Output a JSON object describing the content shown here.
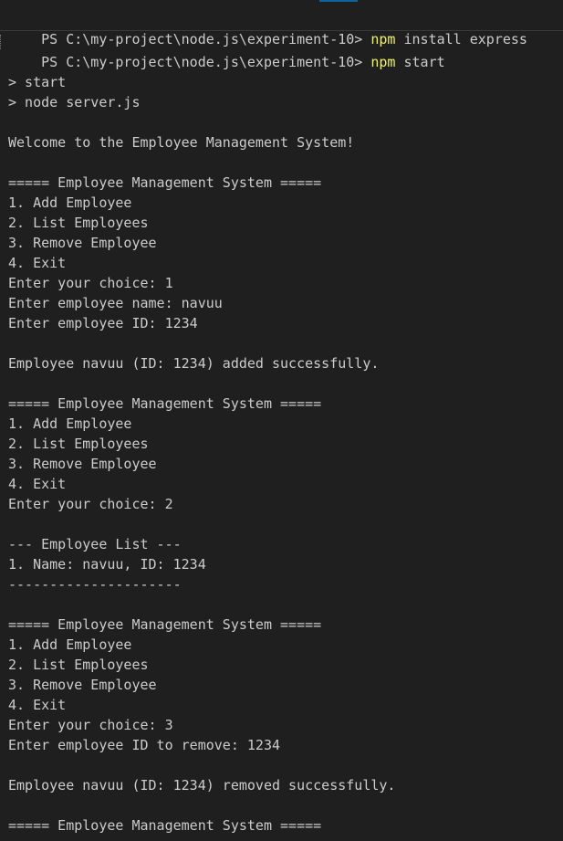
{
  "terminal": {
    "prompts": [
      {
        "ps": "PS C:\\my-project\\node.js\\experiment-10> ",
        "cmd": "npm",
        "args": " install express"
      },
      {
        "ps": "PS C:\\my-project\\node.js\\experiment-10> ",
        "cmd": "npm",
        "args": " start"
      }
    ],
    "output": [
      "",
      "> start",
      "> node server.js",
      "",
      "Welcome to the Employee Management System!",
      "",
      "===== Employee Management System =====",
      "1. Add Employee",
      "2. List Employees",
      "3. Remove Employee",
      "4. Exit",
      "Enter your choice: 1",
      "Enter employee name: navuu",
      "Enter employee ID: 1234",
      "",
      "Employee navuu (ID: 1234) added successfully.",
      "",
      "===== Employee Management System =====",
      "1. Add Employee",
      "2. List Employees",
      "3. Remove Employee",
      "4. Exit",
      "Enter your choice: 2",
      "",
      "--- Employee List ---",
      "1. Name: navuu, ID: 1234",
      "---------------------",
      "",
      "===== Employee Management System =====",
      "1. Add Employee",
      "2. List Employees",
      "3. Remove Employee",
      "4. Exit",
      "Enter your choice: 3",
      "Enter employee ID to remove: 1234",
      "",
      "Employee navuu (ID: 1234) removed successfully.",
      "",
      "===== Employee Management System ====="
    ]
  },
  "colors": {
    "background": "#1f1f1f",
    "text": "#cccccc",
    "command": "#f1f16a"
  }
}
